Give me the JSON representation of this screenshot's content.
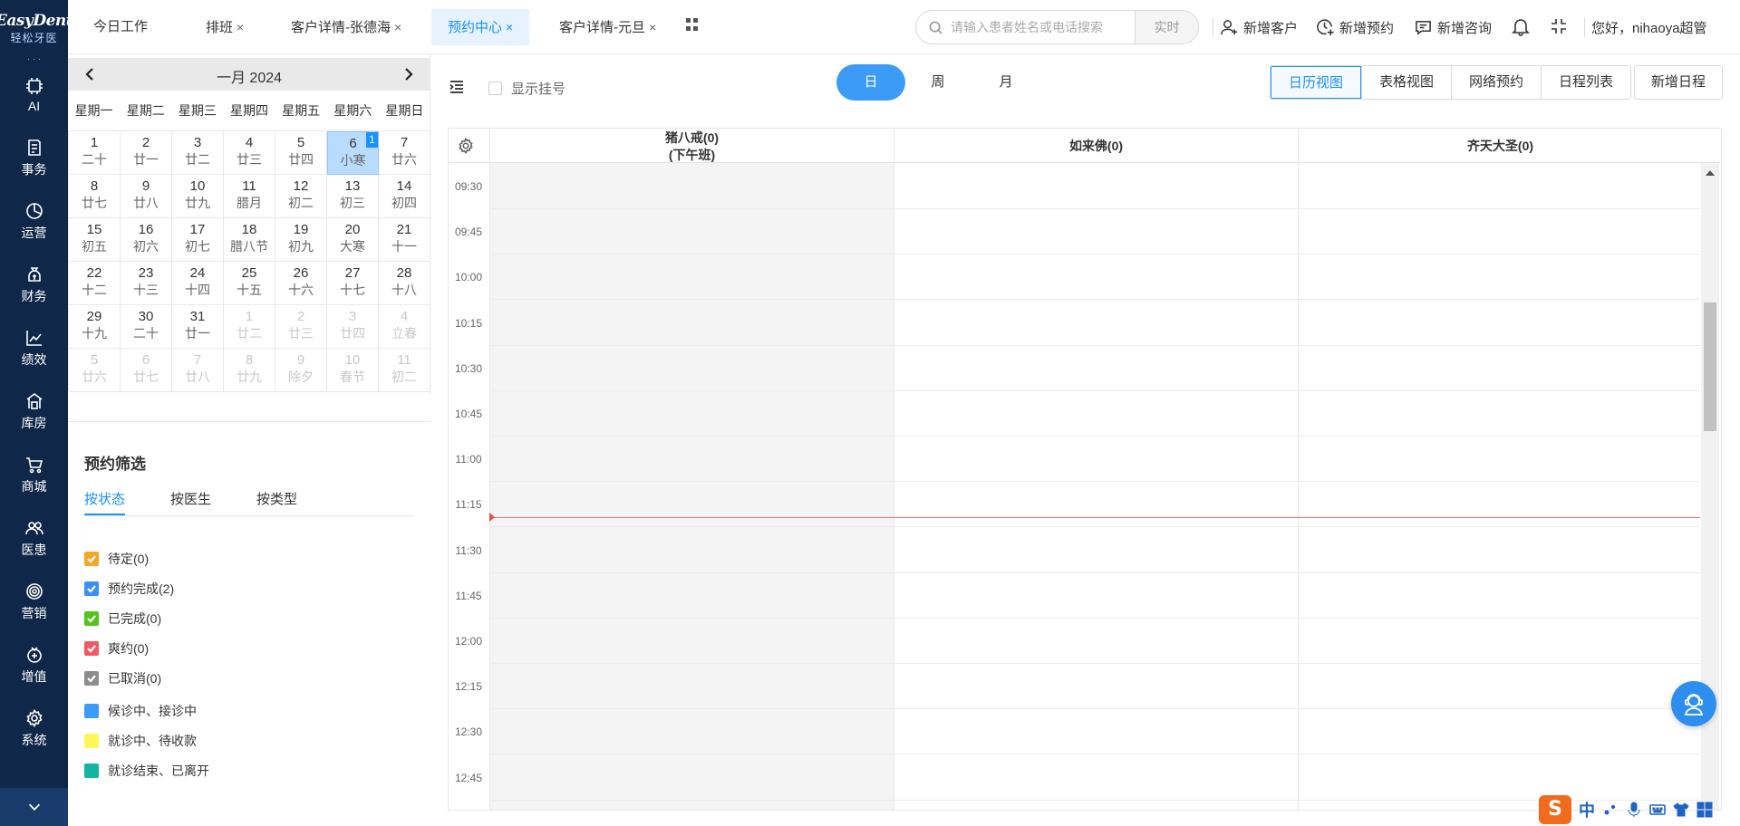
{
  "brand": {
    "logo_text": "EasyDent",
    "logo_sub": "轻松牙医"
  },
  "leftnav": {
    "overflow_dots": "· · ·",
    "items": [
      {
        "label": "AI",
        "icon": "ai-chip-icon"
      },
      {
        "label": "事务",
        "icon": "task-list-icon"
      },
      {
        "label": "运营",
        "icon": "pie-chart-icon"
      },
      {
        "label": "财务",
        "icon": "money-bag-icon"
      },
      {
        "label": "绩效",
        "icon": "trend-chart-icon"
      },
      {
        "label": "库房",
        "icon": "warehouse-icon"
      },
      {
        "label": "商城",
        "icon": "shopping-cart-icon"
      },
      {
        "label": "医患",
        "icon": "people-icon"
      },
      {
        "label": "营销",
        "icon": "target-icon"
      },
      {
        "label": "增值",
        "icon": "value-added-icon"
      },
      {
        "label": "系统",
        "icon": "gear-icon"
      }
    ],
    "collapse_icon": "chevron-down-icon"
  },
  "tabs": [
    {
      "label": "今日工作",
      "closable": false,
      "active": false
    },
    {
      "label": "排班",
      "closable": true,
      "active": false
    },
    {
      "label": "客户详情-张德海",
      "closable": true,
      "active": false
    },
    {
      "label": "预约中心",
      "closable": true,
      "active": true
    },
    {
      "label": "客户详情-元旦",
      "closable": true,
      "active": false
    }
  ],
  "tab_close": "×",
  "search": {
    "placeholder": "请输入患者姓名或电话搜索",
    "value": "",
    "mode": "实时"
  },
  "actions": {
    "new_customer": "新增客户",
    "new_appointment": "新增预约",
    "new_consult": "新增咨询"
  },
  "user": {
    "greeting": "您好，nihaoya超管"
  },
  "calendar": {
    "title": "一月 2024",
    "weekdays": [
      "星期一",
      "星期二",
      "星期三",
      "星期四",
      "星期五",
      "星期六",
      "星期日"
    ],
    "cells": [
      {
        "day": "1",
        "lunar": "二十",
        "other": false
      },
      {
        "day": "2",
        "lunar": "廿一",
        "other": false
      },
      {
        "day": "3",
        "lunar": "廿二",
        "other": false
      },
      {
        "day": "4",
        "lunar": "廿三",
        "other": false
      },
      {
        "day": "5",
        "lunar": "廿四",
        "other": false
      },
      {
        "day": "6",
        "lunar": "小寒",
        "other": false,
        "selected": true,
        "badge": "1"
      },
      {
        "day": "7",
        "lunar": "廿六",
        "other": false
      },
      {
        "day": "8",
        "lunar": "廿七",
        "other": false
      },
      {
        "day": "9",
        "lunar": "廿八",
        "other": false
      },
      {
        "day": "10",
        "lunar": "廿九",
        "other": false
      },
      {
        "day": "11",
        "lunar": "腊月",
        "other": false
      },
      {
        "day": "12",
        "lunar": "初二",
        "other": false
      },
      {
        "day": "13",
        "lunar": "初三",
        "other": false
      },
      {
        "day": "14",
        "lunar": "初四",
        "other": false
      },
      {
        "day": "15",
        "lunar": "初五",
        "other": false
      },
      {
        "day": "16",
        "lunar": "初六",
        "other": false
      },
      {
        "day": "17",
        "lunar": "初七",
        "other": false
      },
      {
        "day": "18",
        "lunar": "腊八节",
        "other": false
      },
      {
        "day": "19",
        "lunar": "初九",
        "other": false
      },
      {
        "day": "20",
        "lunar": "大寒",
        "other": false
      },
      {
        "day": "21",
        "lunar": "十一",
        "other": false
      },
      {
        "day": "22",
        "lunar": "十二",
        "other": false
      },
      {
        "day": "23",
        "lunar": "十三",
        "other": false
      },
      {
        "day": "24",
        "lunar": "十四",
        "other": false
      },
      {
        "day": "25",
        "lunar": "十五",
        "other": false
      },
      {
        "day": "26",
        "lunar": "十六",
        "other": false
      },
      {
        "day": "27",
        "lunar": "十七",
        "other": false
      },
      {
        "day": "28",
        "lunar": "十八",
        "other": false
      },
      {
        "day": "29",
        "lunar": "十九",
        "other": false
      },
      {
        "day": "30",
        "lunar": "二十",
        "other": false
      },
      {
        "day": "31",
        "lunar": "廿一",
        "other": false
      },
      {
        "day": "1",
        "lunar": "廿二",
        "other": true
      },
      {
        "day": "2",
        "lunar": "廿三",
        "other": true
      },
      {
        "day": "3",
        "lunar": "廿四",
        "other": true
      },
      {
        "day": "4",
        "lunar": "立春",
        "other": true
      },
      {
        "day": "5",
        "lunar": "廿六",
        "other": true
      },
      {
        "day": "6",
        "lunar": "廿七",
        "other": true
      },
      {
        "day": "7",
        "lunar": "廿八",
        "other": true
      },
      {
        "day": "8",
        "lunar": "廿九",
        "other": true
      },
      {
        "day": "9",
        "lunar": "除夕",
        "other": true
      },
      {
        "day": "10",
        "lunar": "春节",
        "other": true
      },
      {
        "day": "11",
        "lunar": "初二",
        "other": true
      }
    ]
  },
  "filter": {
    "title": "预约筛选",
    "tabs": [
      "按状态",
      "按医生",
      "按类型"
    ],
    "statuses": [
      {
        "label": "待定(0)",
        "color": "#f5a623",
        "checked": true
      },
      {
        "label": "预约完成(2)",
        "color": "#3b8ff5",
        "checked": true
      },
      {
        "label": "已完成(0)",
        "color": "#52c41a",
        "checked": true
      },
      {
        "label": "爽约(0)",
        "color": "#f05a63",
        "checked": true
      },
      {
        "label": "已取消(0)",
        "color": "#8c8c8c",
        "checked": true
      }
    ],
    "legend": [
      {
        "label": "候诊中、接诊中",
        "color": "#3b9bf7"
      },
      {
        "label": "就诊中、待收款",
        "color": "#fdf75a"
      },
      {
        "label": "就诊结束、已离开",
        "color": "#12b5a2"
      }
    ]
  },
  "toolbar": {
    "show_registration": "显示挂号",
    "scope": [
      "日",
      "周",
      "月"
    ],
    "active_scope": "日",
    "views": [
      "日历视图",
      "表格视图",
      "网络预约",
      "日程列表"
    ],
    "active_view": "日历视图",
    "new_schedule": "新增日程"
  },
  "schedule": {
    "columns": [
      {
        "name": "猪八戒(0)",
        "sub": "(下午班)",
        "off_duty": true
      },
      {
        "name": "如来佛(0)",
        "sub": "",
        "off_duty": false
      },
      {
        "name": "齐天大圣(0)",
        "sub": "",
        "off_duty": false
      }
    ],
    "times": [
      "09:30",
      "09:45",
      "10:00",
      "10:15",
      "10:30",
      "10:45",
      "11:00",
      "11:15",
      "11:30",
      "11:45",
      "12:00",
      "12:15",
      "12:30",
      "12:45"
    ],
    "current_time_label": "11:22"
  },
  "ime": {
    "zh": "中",
    "logo": "S"
  }
}
